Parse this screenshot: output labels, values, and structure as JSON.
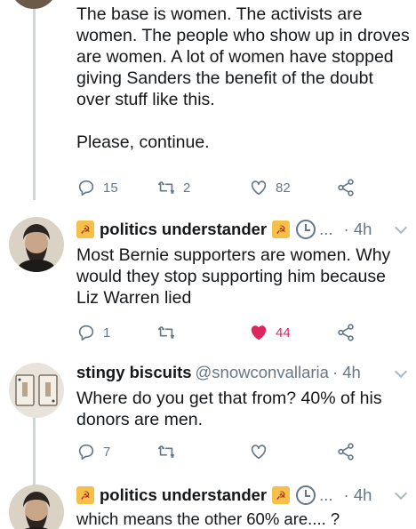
{
  "tweets": [
    {
      "text": "The base is women. The activists are women. The people who show up in droves are women. A lot of women have stopped giving Sanders the benefit of the doubt over stuff like this.\n\nPlease, continue.",
      "replies": "15",
      "retweets": "2",
      "likes": "82"
    },
    {
      "name": "politics understander",
      "dots": "...",
      "time": "· 4h",
      "text": "Most Bernie supporters are women. Why would they stop supporting him because Liz Warren lied",
      "replies": "1",
      "retweets": "",
      "likes": "44"
    },
    {
      "name": "stingy biscuits",
      "handle": "@snowconvallaria",
      "time": "· 4h",
      "text": "Where do you get that from? 40% of his donors are men.",
      "replies": "7",
      "retweets": "",
      "likes": ""
    },
    {
      "name": "politics understander",
      "dots": "...",
      "time": "· 4h",
      "text": "which means the other 60% are.... ?"
    }
  ],
  "badge_glyph": "☭",
  "colors": {
    "like": "#e0245e",
    "icon": "#657786",
    "badge": "#f5c04a"
  },
  "icons": [
    "reply-icon",
    "retweet-icon",
    "heart-icon",
    "share-icon",
    "clock-icon",
    "chevron-down-icon"
  ]
}
